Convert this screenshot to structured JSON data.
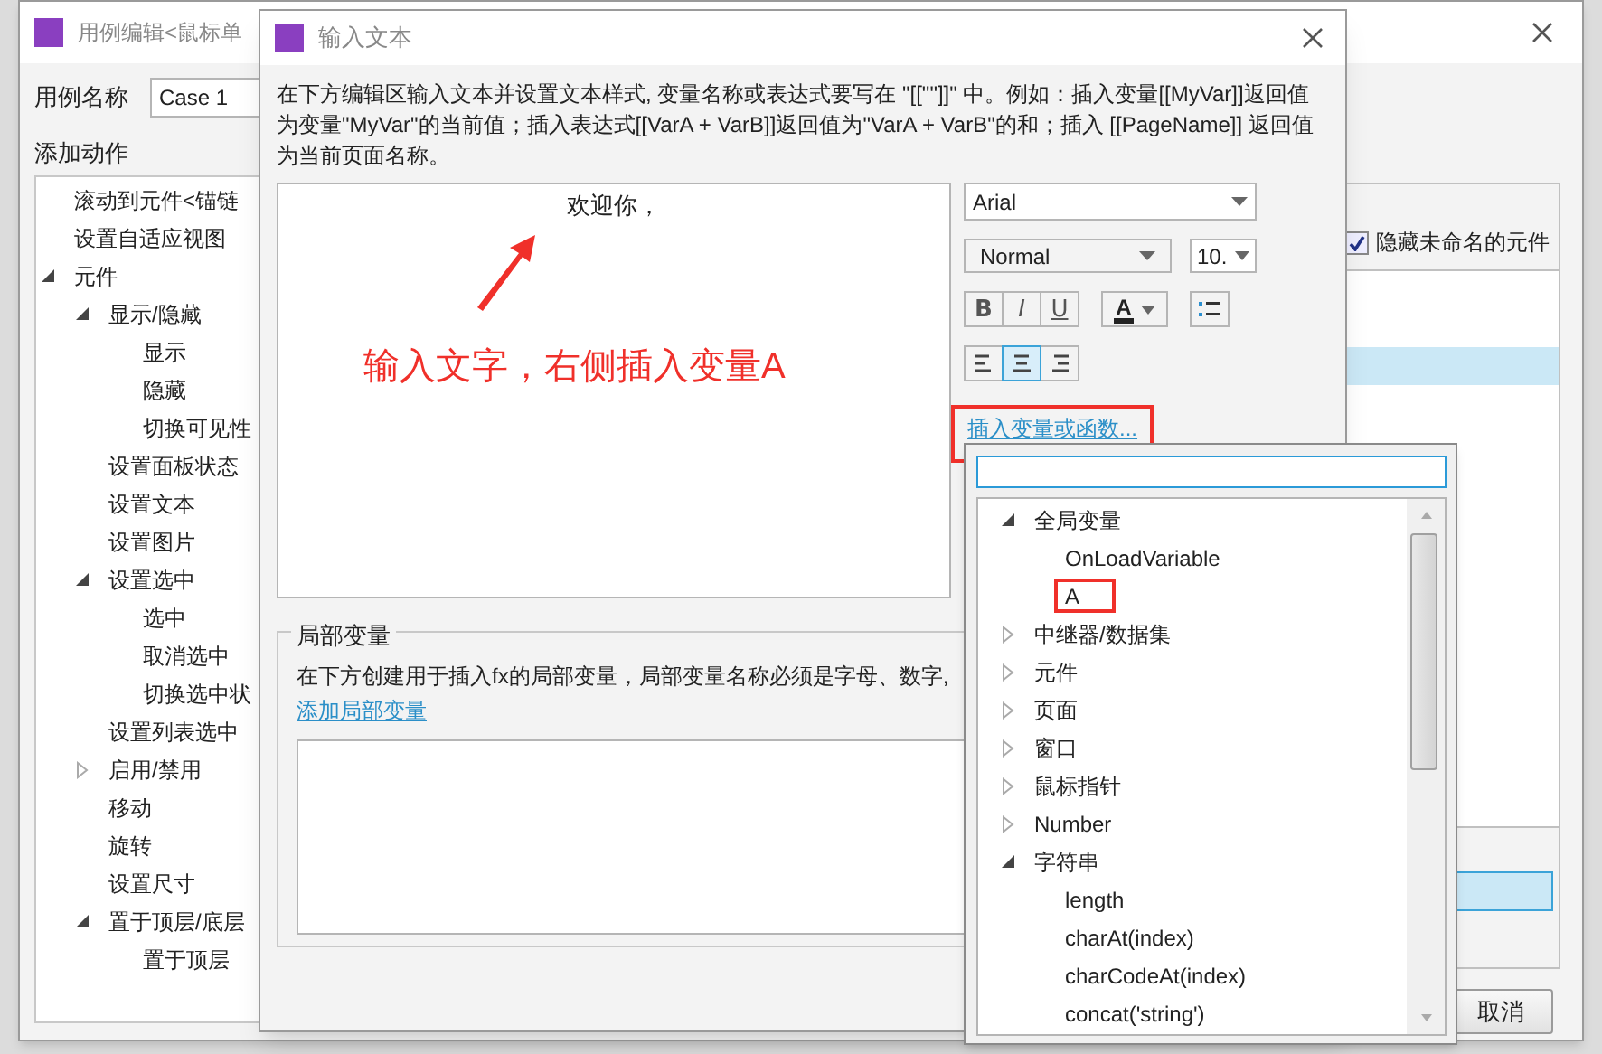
{
  "case_editor": {
    "title": "用例编辑<鼠标单",
    "case_name_label": "用例名称",
    "case_name_value": "Case 1",
    "actions_label": "添加动作",
    "actions_tree": [
      {
        "label": "滚动到元件<锚链"
      },
      {
        "label": "设置自适应视图"
      },
      {
        "label": "元件",
        "expanded": true,
        "children": [
          {
            "label": "显示/隐藏",
            "expanded": true,
            "children": [
              {
                "label": "显示"
              },
              {
                "label": "隐藏"
              },
              {
                "label": "切换可见性"
              }
            ]
          },
          {
            "label": "设置面板状态"
          },
          {
            "label": "设置文本"
          },
          {
            "label": "设置图片"
          },
          {
            "label": "设置选中",
            "expanded": true,
            "children": [
              {
                "label": "选中"
              },
              {
                "label": "取消选中"
              },
              {
                "label": "切换选中状"
              }
            ]
          },
          {
            "label": "设置列表选中"
          },
          {
            "label": "启用/禁用",
            "expanded": false
          },
          {
            "label": "移动"
          },
          {
            "label": "旋转"
          },
          {
            "label": "设置尺寸"
          },
          {
            "label": "置于顶层/底层",
            "expanded": true,
            "children": [
              {
                "label": "置于顶层"
              }
            ]
          }
        ]
      }
    ],
    "hide_unnamed": {
      "label": "隐藏未命名的元件",
      "checked": true
    },
    "widget_rows": [
      {
        "selected": false
      },
      {
        "selected": false
      },
      {
        "selected": true
      },
      {
        "selected": false
      }
    ],
    "cancel_button": "取消"
  },
  "text_dialog": {
    "title": "输入文本",
    "description": "在下方编辑区输入文本并设置文本样式, 变量名称或表达式要写在 \"[[\"\"]]\" 中。例如：插入变量[[MyVar]]返回值为变量\"MyVar\"的当前值；插入表达式[[VarA + VarB]]返回值为\"VarA + VarB\"的和；插入 [[PageName]] 返回值为当前页面名称。",
    "editor_text": "欢迎你，",
    "font_family": "Arial",
    "font_style": "Normal",
    "font_size": "10.",
    "format_buttons": [
      {
        "kind": "bold",
        "label": "B"
      },
      {
        "kind": "italic",
        "label": "I"
      },
      {
        "kind": "underline",
        "label": "U"
      }
    ],
    "text_color_label": "A",
    "align_buttons": [
      {
        "kind": "left",
        "selected": false
      },
      {
        "kind": "center",
        "selected": true
      },
      {
        "kind": "right",
        "selected": false
      }
    ],
    "insert_link": {
      "label": "插入变量或函数...",
      "marked": true
    },
    "local_variables": {
      "title": "局部变量",
      "description": "在下方创建用于插入fx的局部变量，局部变量名称必须是字母、数字,",
      "add_link": "添加局部变量"
    }
  },
  "variable_popup": {
    "tree": [
      {
        "label": "全局变量",
        "expanded": true,
        "children": [
          {
            "label": "OnLoadVariable",
            "marked": false
          },
          {
            "label": "A",
            "marked": true
          }
        ]
      },
      {
        "label": "中继器/数据集",
        "expanded": false
      },
      {
        "label": "元件",
        "expanded": false
      },
      {
        "label": "页面",
        "expanded": false
      },
      {
        "label": "窗口",
        "expanded": false
      },
      {
        "label": "鼠标指针",
        "expanded": false
      },
      {
        "label": "Number",
        "expanded": false
      },
      {
        "label": "字符串",
        "expanded": true,
        "children": [
          {
            "label": "length",
            "marked": false
          },
          {
            "label": "charAt(index)",
            "marked": false
          },
          {
            "label": "charCodeAt(index)",
            "marked": false
          },
          {
            "label": "concat('string')",
            "marked": false
          }
        ]
      }
    ]
  },
  "annotation": {
    "text": "输入文字，右侧插入变量A"
  }
}
